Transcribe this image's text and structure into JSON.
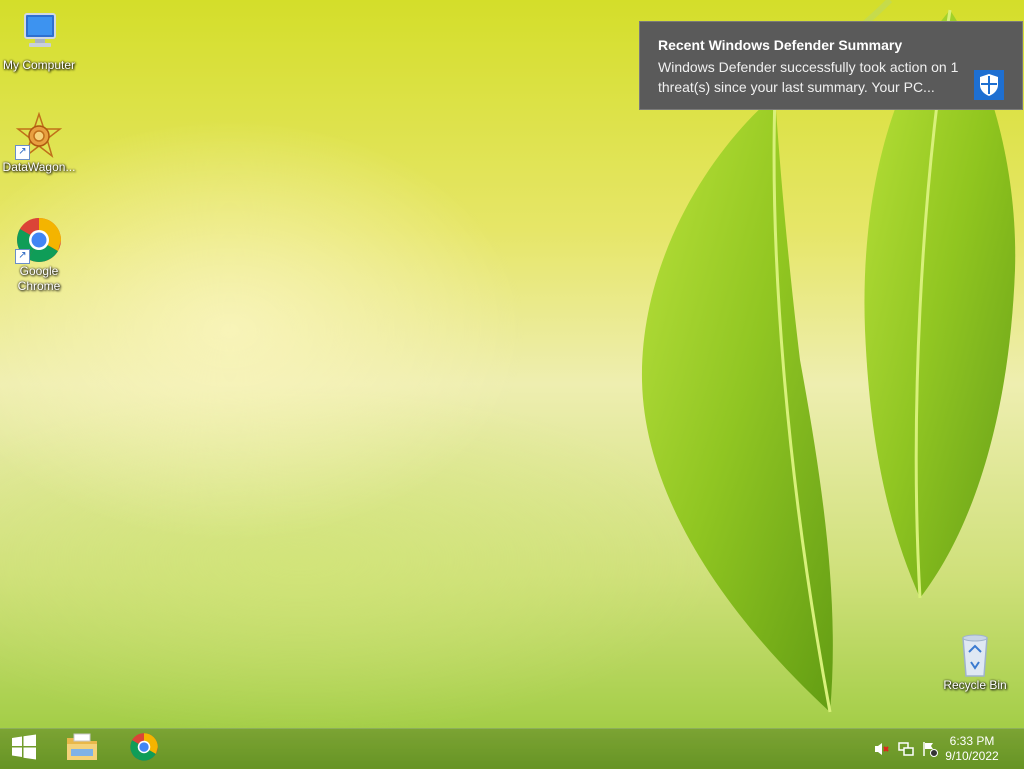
{
  "desktop": {
    "icons": [
      {
        "label": "My Computer",
        "icon": "computer-icon"
      },
      {
        "label": "DataWagon...",
        "icon": "datawagon-icon"
      },
      {
        "label": "Google Chrome",
        "icon": "chrome-icon"
      },
      {
        "label": "Recycle Bin",
        "icon": "recycle-bin-icon"
      }
    ]
  },
  "notification": {
    "title": "Recent Windows Defender Summary",
    "body": "Windows Defender successfully took action on 1 threat(s) since your last summary. Your PC...",
    "icon": "windows-defender-shield-icon"
  },
  "taskbar": {
    "start_icon": "windows-start-icon",
    "pinned": [
      "file-explorer-icon",
      "chrome-icon"
    ],
    "tray": [
      "volume-muted-icon",
      "network-icon",
      "action-center-flag-icon"
    ],
    "time": "6:33 PM",
    "date": "9/10/2022"
  },
  "colors": {
    "toast_bg": "#5a5a5a",
    "defender_blue": "#1e6fd1",
    "taskbar": "#74a034"
  }
}
